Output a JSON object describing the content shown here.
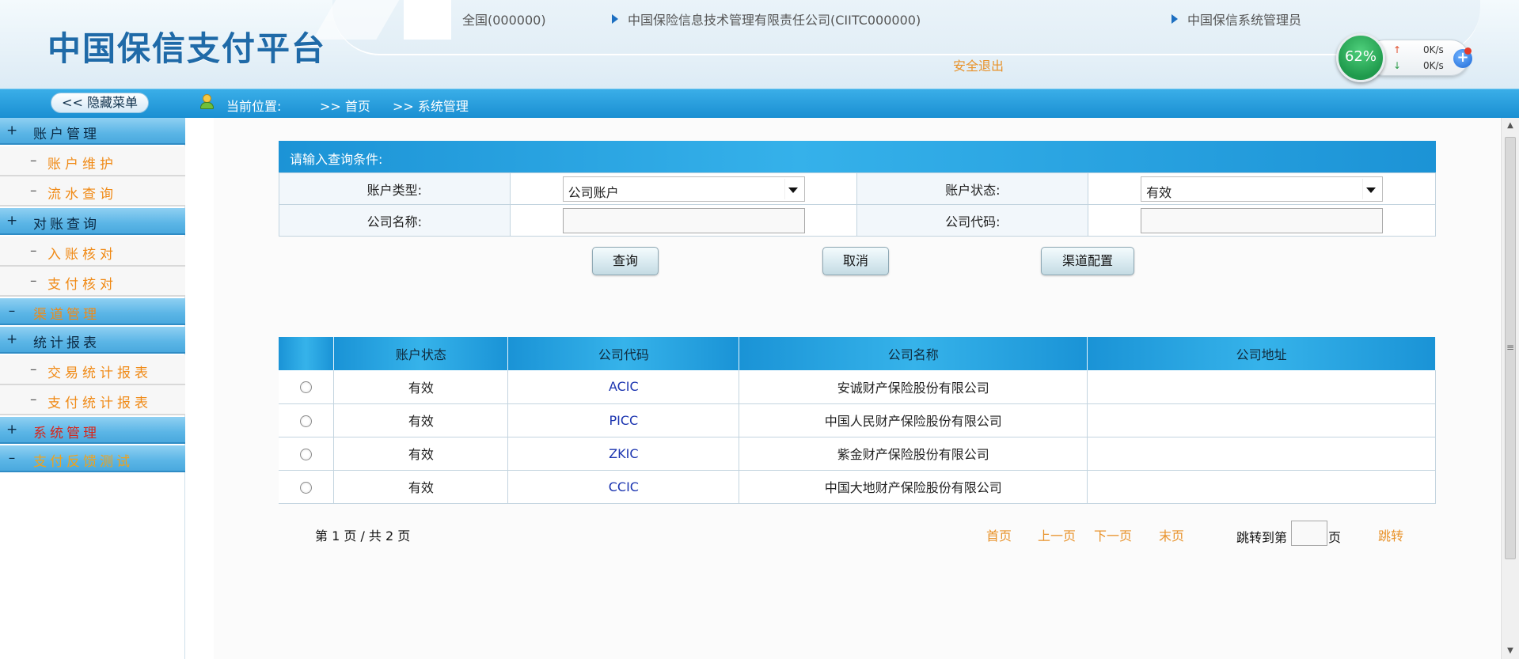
{
  "header": {
    "app_title": "中国保信支付平台",
    "region": "全国(000000)",
    "company": "中国保险信息技术管理有限责任公司(CIITC000000)",
    "user_role": "中国保信系统管理员",
    "logout_label": "安全退出",
    "monitor": {
      "percent": "62%",
      "up_speed": "0K/s",
      "down_speed": "0K/s"
    }
  },
  "navbar": {
    "hide_menu_label": "<< 隐藏菜单",
    "location_label": "当前位置:",
    "breadcrumbs": [
      ">> 首页",
      ">> 系统管理"
    ]
  },
  "sidebar": {
    "items": [
      {
        "sign": "+",
        "label": "账户管理"
      },
      {
        "sign": "–",
        "label": "账户维护"
      },
      {
        "sign": "–",
        "label": "流水查询"
      },
      {
        "sign": "+",
        "label": "对账查询"
      },
      {
        "sign": "–",
        "label": "入账核对"
      },
      {
        "sign": "–",
        "label": "支付核对"
      },
      {
        "sign": "–",
        "label": "渠道管理"
      },
      {
        "sign": "+",
        "label": "统计报表"
      },
      {
        "sign": "–",
        "label": "交易统计报表"
      },
      {
        "sign": "–",
        "label": "支付统计报表"
      },
      {
        "sign": "+",
        "label": "系统管理"
      },
      {
        "sign": "–",
        "label": "支付反馈测试"
      }
    ]
  },
  "query": {
    "title": "请输入查询条件:",
    "account_type_label": "账户类型:",
    "account_type_value": "公司账户",
    "account_status_label": "账户状态:",
    "account_status_value": "有效",
    "company_name_label": "公司名称:",
    "company_name_value": "",
    "company_code_label": "公司代码:",
    "company_code_value": "",
    "buttons": {
      "search": "查询",
      "cancel": "取消",
      "channel_config": "渠道配置"
    }
  },
  "results": {
    "columns": [
      "",
      "账户状态",
      "公司代码",
      "公司名称",
      "公司地址"
    ],
    "rows": [
      {
        "status": "有效",
        "code": "ACIC",
        "name": "安诚财产保险股份有限公司",
        "address": ""
      },
      {
        "status": "有效",
        "code": "PICC",
        "name": "中国人民财产保险股份有限公司",
        "address": ""
      },
      {
        "status": "有效",
        "code": "ZKIC",
        "name": "紫金财产保险股份有限公司",
        "address": ""
      },
      {
        "status": "有效",
        "code": "CCIC",
        "name": "中国大地财产保险股份有限公司",
        "address": ""
      }
    ]
  },
  "pager": {
    "info": "第 1 页 / 共 2 页",
    "first": "首页",
    "prev": "上一页",
    "next": "下一页",
    "last": "末页",
    "jump_prefix": "跳转到第",
    "jump_suffix": "页",
    "jump_button": "跳转"
  },
  "colors": {
    "accent_blue": "#1a93d6",
    "link_orange": "#e8922a",
    "title_blue": "#1f6aa8"
  }
}
